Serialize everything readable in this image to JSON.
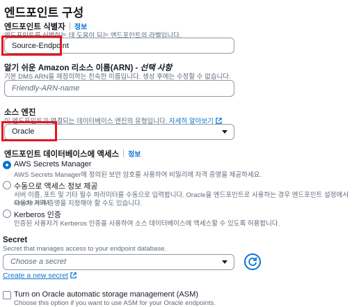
{
  "page": {
    "title": "엔드포인트 구성"
  },
  "identifier": {
    "label": "엔드포인트 식별자",
    "info": "정보",
    "description": "엔드포인트를 식별하는 데 도움이 되는 엔드포인트의 라벨입니다.",
    "value": "Source-Endpoint"
  },
  "arn": {
    "label_main": "알기 쉬운 Amazon 리소스 이름(ARN) - ",
    "label_optional": "선택 사항",
    "description": "기본 DMS ARN을 재정의하는 친숙한 이름입니다. 생성 후에는 수정할 수 없습니다.",
    "placeholder": "Friendly-ARN-name"
  },
  "source_engine": {
    "label": "소스 엔진",
    "description": "이 엔드포인트가 연결되는 데이터베이스 엔진의 유형입니다.",
    "learn_more": "자세히 알아보기",
    "value": "Oracle"
  },
  "access": {
    "label": "엔드포인트 데이터베이스에 액세스",
    "info": "정보",
    "options": [
      {
        "title": "AWS Secrets Manager",
        "description": "AWS Secrets Manager에 정의된 보안 암호를 사용하여 비밀리에 자격 증명을 제공하세요.",
        "selected": true
      },
      {
        "title": "수동으로 액세스 정보 제공",
        "description_line1": "서버 이름, 포트 및 기타 필수 파라미터를 수동으로 입력합니다. Oracle을 엔드포인트로 사용하는 경우 엔드포인트 설정에서 Oracle ASM",
        "description_line2": "사용자 자격 증명을 지정해야 할 수도 있습니다.",
        "selected": false
      },
      {
        "title": "Kerberos 인증",
        "description": "인증된 사용자가 Kerberos 인증을 사용하여 소스 데이터베이스에 액세스할 수 있도록 허용합니다.",
        "selected": false
      }
    ]
  },
  "secret": {
    "label": "Secret",
    "description": "Secret that manages access to your endpoint database.",
    "placeholder": "Choose a secret",
    "create_link": "Create a new secret"
  },
  "asm": {
    "label": "Turn on Oracle automatic storage management (ASM)",
    "description": "Choose this option if you want to use ASM for your Oracle endpoints.",
    "checked": false
  },
  "colors": {
    "accent": "#0972d3",
    "highlight": "#e4151f",
    "text": "#16191f",
    "muted": "#5f6b7a"
  },
  "icons": [
    "external-link-icon",
    "refresh-icon",
    "caret-down-icon"
  ]
}
